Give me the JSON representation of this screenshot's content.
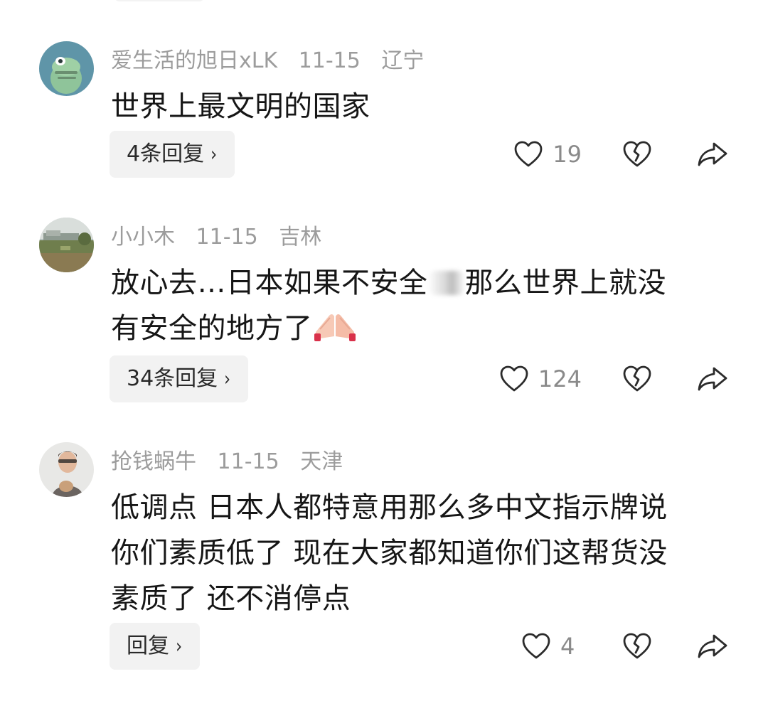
{
  "comments": [
    {
      "username": "爱生活的旭日xLK",
      "date": "11-15",
      "location": "辽宁",
      "lines": [
        "世界上最文明的国家"
      ],
      "reply_label": "4条回复",
      "like_count": "19",
      "avatar": "green-frog-avatar"
    },
    {
      "username": "小小木",
      "date": "11-15",
      "location": "吉林",
      "lines": [
        "放心去…日本如果不安全",
        "那么世界上就没",
        "有安全的地方了"
      ],
      "reply_label": "34条回复",
      "like_count": "124",
      "avatar": "landscape-photo-avatar",
      "emoji": "pressed-hands-emoji"
    },
    {
      "username": "抢钱蜗牛",
      "date": "11-15",
      "location": "天津",
      "lines": [
        "低调点 日本人都特意用那么多中文指示牌说",
        "你们素质低了 现在大家都知道你们这帮货没",
        "素质了 还不消停点"
      ],
      "reply_label": "回复",
      "like_count": "4",
      "avatar": "person-portrait-avatar"
    }
  ],
  "icons": {
    "like": "heart-outline-icon",
    "dislike": "broken-heart-icon",
    "share": "share-arrow-icon",
    "reply_chevron": "chevron-right-icon"
  },
  "chevron": "›"
}
